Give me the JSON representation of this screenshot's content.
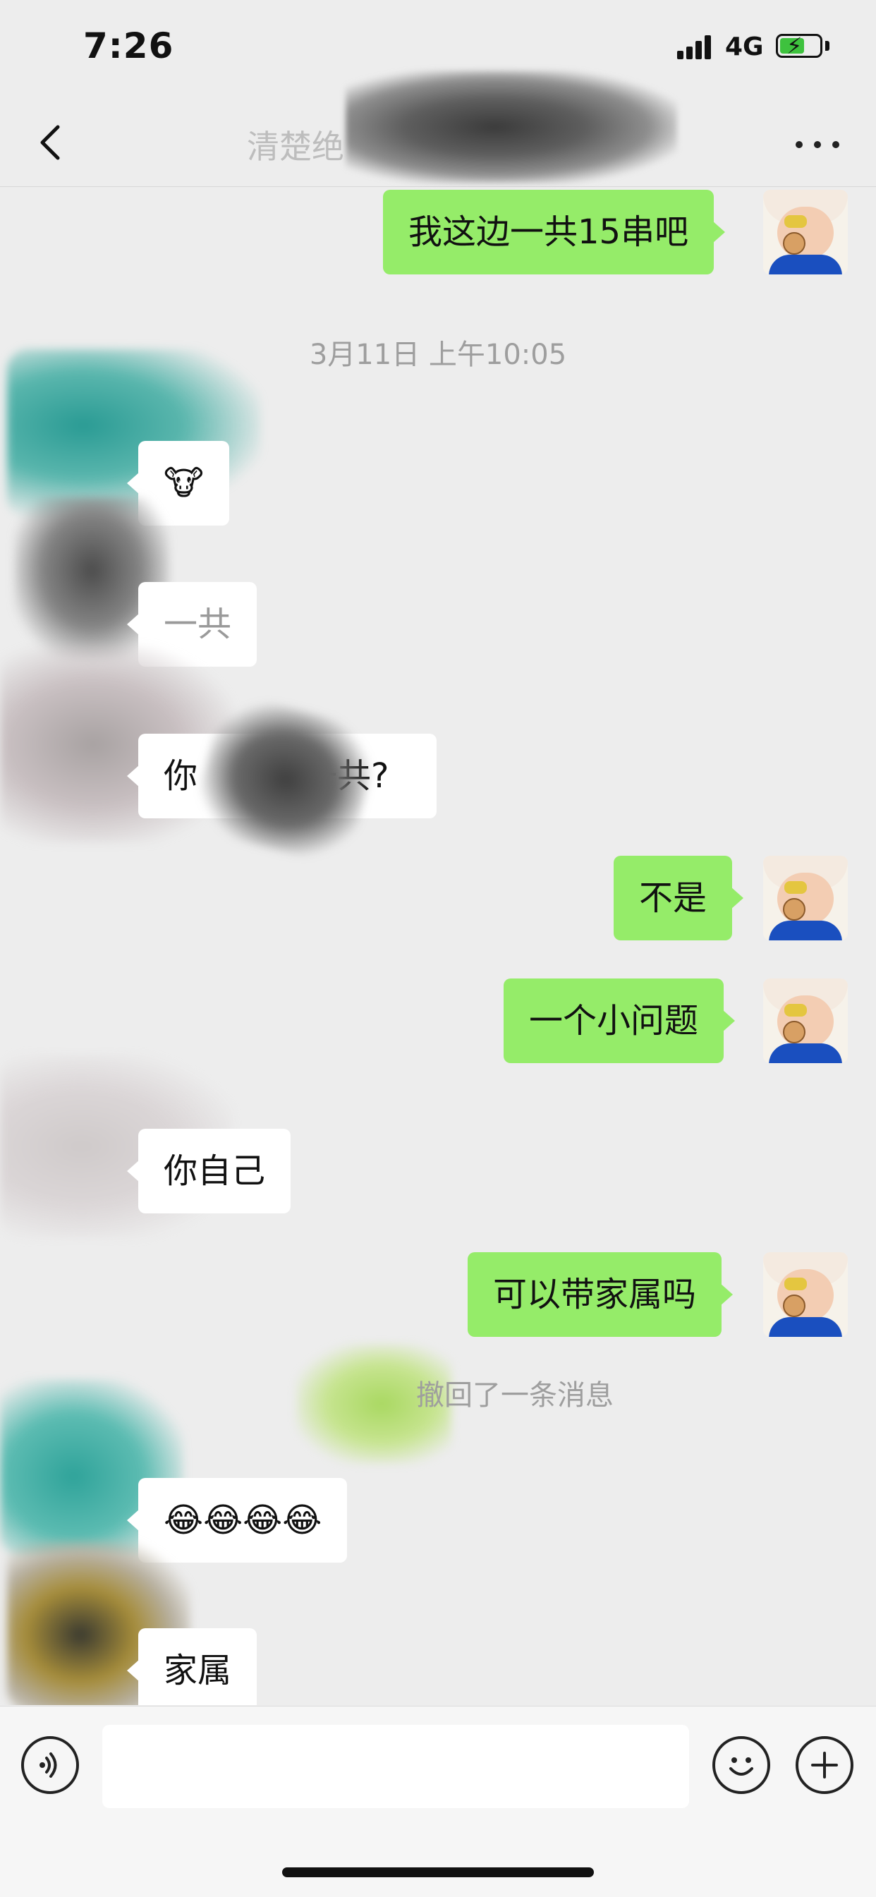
{
  "status_bar": {
    "time": "7:26",
    "network": "4G"
  },
  "nav": {
    "title": "清楚绝"
  },
  "messages": {
    "m1": "我这边一共15串吧",
    "timestamp": "3月11日 上午10:05",
    "m2": "🐮",
    "m3": "一共",
    "m4_prefix": "你",
    "m4_suffix": "一共?",
    "m5": "不是",
    "m6": "一个小问题",
    "m7": "你自己",
    "m8": "可以带家属吗",
    "recall": "撤回了一条消息",
    "m9": "😂😂😂😂",
    "m10": "家属"
  },
  "colors": {
    "my_bubble": "#95ec69",
    "their_bubble": "#ffffff",
    "background": "#ededed"
  },
  "icons": {
    "back": "chevron-left-icon",
    "more": "ellipsis-icon",
    "voice": "voice-icon",
    "emoji": "emoji-icon",
    "plus": "plus-icon"
  }
}
